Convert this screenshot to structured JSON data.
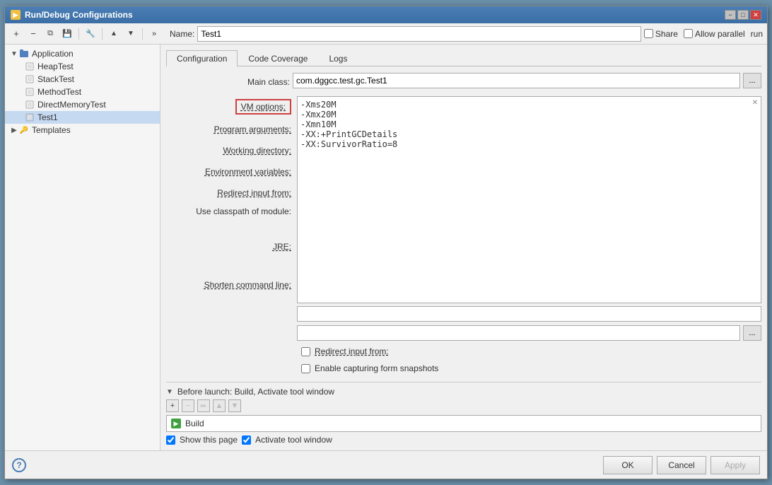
{
  "window": {
    "title": "Run/Debug Configurations"
  },
  "toolbar": {
    "add_label": "+",
    "remove_label": "−",
    "copy_label": "⧉",
    "save_label": "💾",
    "wrench_label": "🔧",
    "up_label": "▲",
    "down_label": "▼",
    "more_label": "»"
  },
  "name_bar": {
    "label": "Name:",
    "value": "Test1",
    "share_label": "Share",
    "allow_parallel_label": "Allow parallel",
    "run_label": "run"
  },
  "sidebar": {
    "items": [
      {
        "id": "application",
        "label": "Application",
        "level": 0,
        "expanded": true,
        "type": "group"
      },
      {
        "id": "heaptest",
        "label": "HeapTest",
        "level": 1,
        "type": "config"
      },
      {
        "id": "stacktest",
        "label": "StackTest",
        "level": 1,
        "type": "config"
      },
      {
        "id": "methodtest",
        "label": "MethodTest",
        "level": 1,
        "type": "config"
      },
      {
        "id": "directmemorytest",
        "label": "DirectMemoryTest",
        "level": 1,
        "type": "config"
      },
      {
        "id": "test1",
        "label": "Test1",
        "level": 1,
        "type": "config",
        "selected": true
      },
      {
        "id": "templates",
        "label": "Templates",
        "level": 0,
        "expanded": false,
        "type": "group"
      }
    ]
  },
  "tabs": [
    {
      "id": "configuration",
      "label": "Configuration",
      "active": true
    },
    {
      "id": "code_coverage",
      "label": "Code Coverage",
      "active": false
    },
    {
      "id": "logs",
      "label": "Logs",
      "active": false
    }
  ],
  "config_form": {
    "main_class_label": "Main class:",
    "main_class_value": "com.dggcc.test.gc.Test1",
    "vm_options_label": "VM options:",
    "vm_options_value": "-Xms20M\n-Xmx20M\n-Xmn10M\n-XX:+PrintGCDetails\n-XX:SurvivorRatio=8",
    "program_args_label": "Program arguments:",
    "working_dir_label": "Working directory:",
    "env_vars_label": "Environment variables:",
    "redirect_label": "Redirect input from:",
    "use_classpath_label": "Use classpath of module:",
    "jre_label": "JRE:",
    "shorten_cmd_label": "Shorten command line:",
    "enable_capturing_label": "Enable capturing form snapshots"
  },
  "before_launch": {
    "header": "Before launch: Build, Activate tool window",
    "build_label": "Build",
    "show_page_label": "Show this page",
    "activate_label": "Activate tool window"
  },
  "bottom": {
    "help_label": "?",
    "ok_label": "OK",
    "cancel_label": "Cancel",
    "apply_label": "Apply"
  }
}
